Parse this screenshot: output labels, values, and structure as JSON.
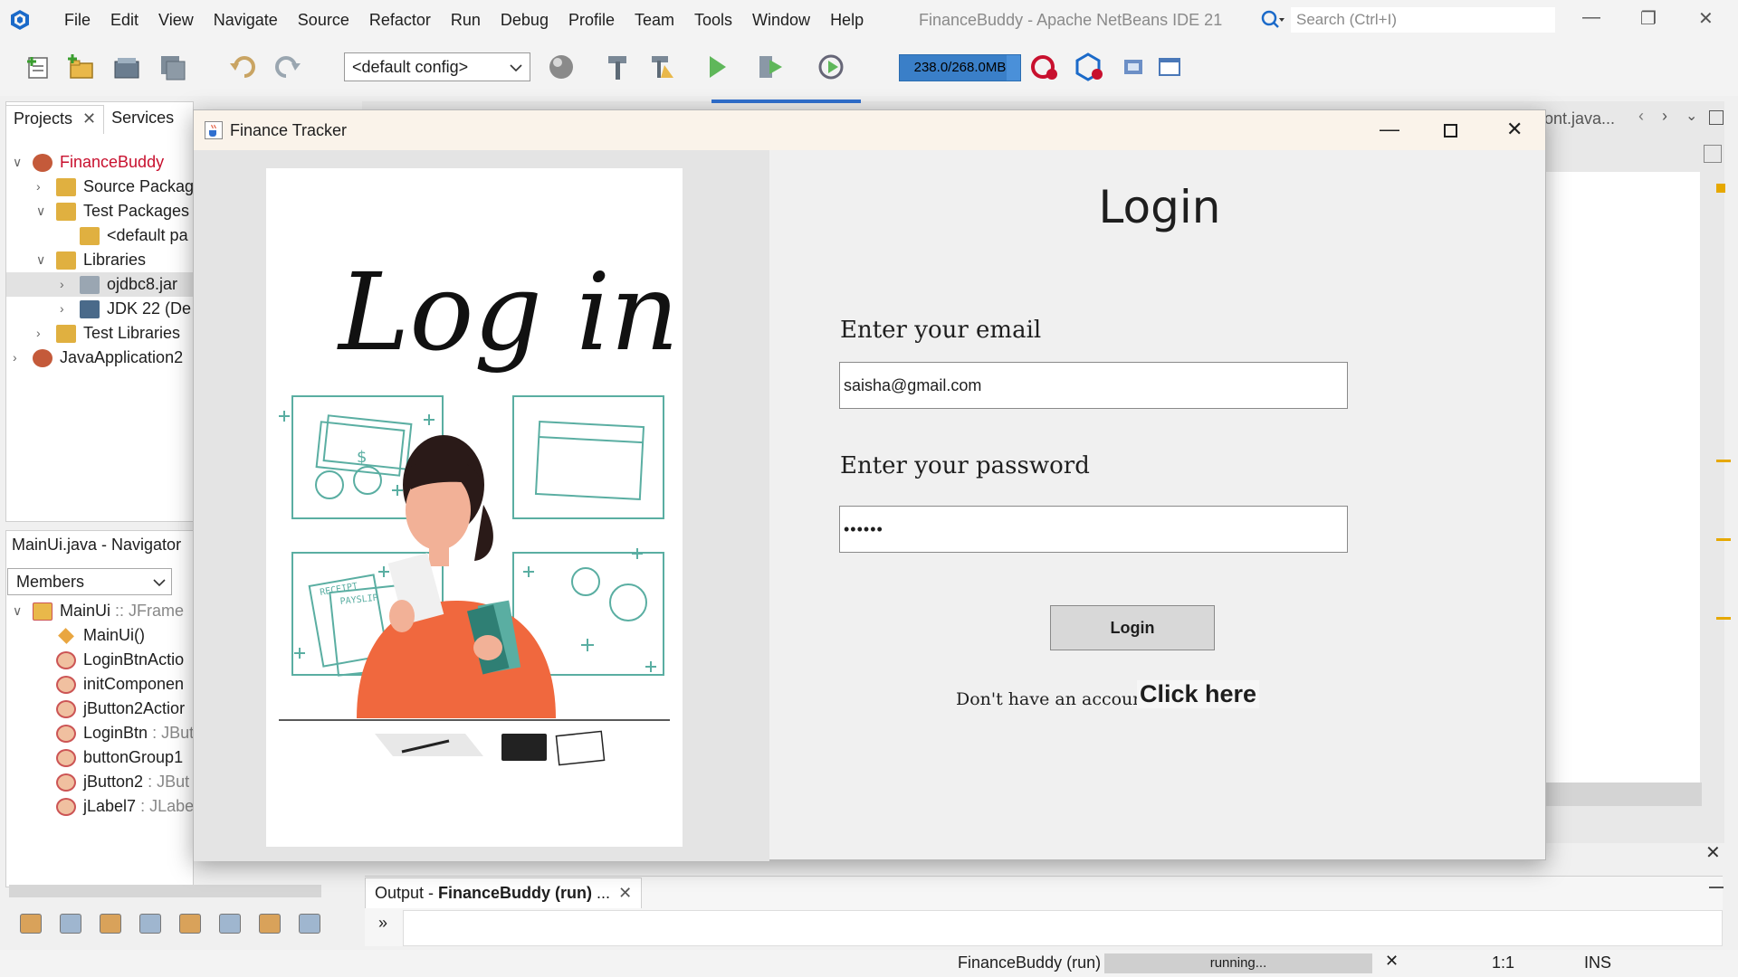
{
  "ide": {
    "window_title": "FinanceBuddy - Apache NetBeans IDE 21",
    "menu": [
      "File",
      "Edit",
      "View",
      "Navigate",
      "Source",
      "Refactor",
      "Run",
      "Debug",
      "Profile",
      "Team",
      "Tools",
      "Window",
      "Help"
    ],
    "search_placeholder": "Search (Ctrl+I)",
    "config_selected": "<default config>",
    "memory": "238.0/268.0MB",
    "memory_fraction": 0.89
  },
  "projects": {
    "tabs": [
      "Projects",
      "Services"
    ],
    "tree": [
      {
        "label": "FinanceBuddy",
        "level": 0,
        "expanded": true,
        "color": "#c8102e"
      },
      {
        "label": "Source Packag",
        "level": 1,
        "expanded": false
      },
      {
        "label": "Test Packages",
        "level": 1,
        "expanded": true
      },
      {
        "label": "<default pa",
        "level": 2,
        "expanded": null
      },
      {
        "label": "Libraries",
        "level": 1,
        "expanded": true
      },
      {
        "label": "ojdbc8.jar",
        "level": 2,
        "expanded": false,
        "selected": true
      },
      {
        "label": "JDK 22 (De",
        "level": 2,
        "expanded": false
      },
      {
        "label": "Test Libraries",
        "level": 1,
        "expanded": false
      },
      {
        "label": "JavaApplication2",
        "level": 0,
        "expanded": false
      }
    ]
  },
  "navigator": {
    "title": "MainUi.java - Navigator",
    "filter": "Members",
    "root": {
      "name": "MainUi",
      "type": ":: JFrame"
    },
    "members": [
      {
        "name": "MainUi()",
        "type": ""
      },
      {
        "name": "LoginBtnActio",
        "type": ""
      },
      {
        "name": "initComponen",
        "type": ""
      },
      {
        "name": "jButton2Actior",
        "type": ""
      },
      {
        "name": "LoginBtn",
        "type": ": JBut"
      },
      {
        "name": "buttonGroup1",
        "type": ""
      },
      {
        "name": "jButton2",
        "type": ": JBut"
      },
      {
        "name": "jLabel7",
        "type": ": JLabe"
      }
    ]
  },
  "editor": {
    "partial_tab": "ont.java..."
  },
  "output": {
    "tab_prefix": "Output - ",
    "tab_bold": "FinanceBuddy (run)",
    "tab_suffix": " ...",
    "arrow": "»"
  },
  "status": {
    "project": "FinanceBuddy (run)",
    "progress": "running...",
    "position": "1:1",
    "mode": "INS"
  },
  "dialog": {
    "title": "Finance Tracker",
    "art_title": "Log in",
    "art_receipt_label": "RECEIPT",
    "art_payslip_label": "PAYSLIP",
    "art_dollar": "$",
    "heading": "Login",
    "email_label": "Enter your email",
    "email_value": "saisha@gmail.com",
    "password_label": "Enter your password",
    "password_value": "••••••",
    "login_button": "Login",
    "no_account_text": "Don't have an account?",
    "signup_link": "Click here"
  }
}
